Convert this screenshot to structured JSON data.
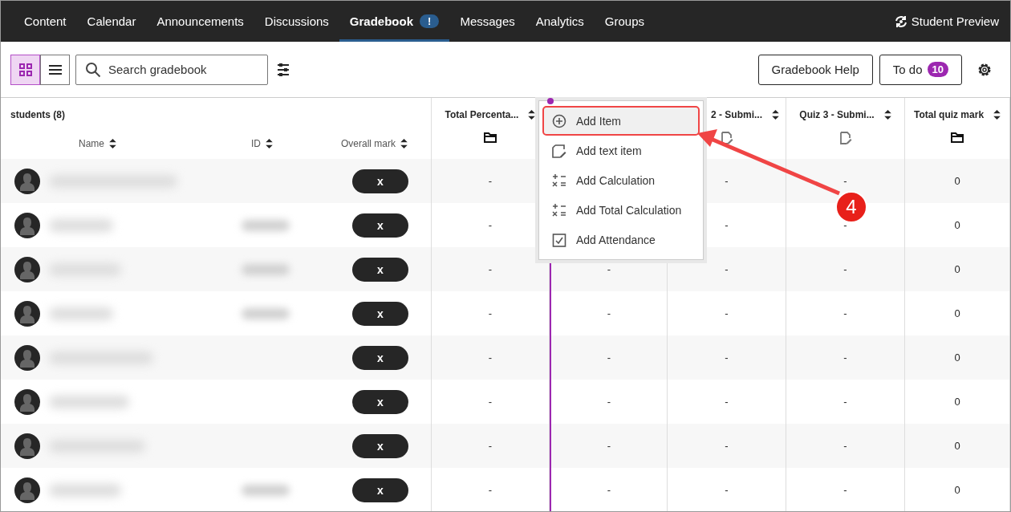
{
  "nav": {
    "tabs": [
      {
        "label": "Content",
        "selected": false
      },
      {
        "label": "Calendar",
        "selected": false
      },
      {
        "label": "Announcements",
        "selected": false
      },
      {
        "label": "Discussions",
        "selected": false
      },
      {
        "label": "Gradebook",
        "selected": true,
        "badge": "!"
      },
      {
        "label": "Messages",
        "selected": false
      },
      {
        "label": "Analytics",
        "selected": false
      },
      {
        "label": "Groups",
        "selected": false
      }
    ],
    "preview": "Student Preview"
  },
  "toolbar": {
    "views": [
      {
        "kind": "grid",
        "selected": true
      },
      {
        "kind": "list",
        "selected": false
      }
    ],
    "search": {
      "placeholder": "Search gradebook"
    },
    "help": "Gradebook Help",
    "todo": {
      "label": "To do",
      "count": "10"
    }
  },
  "students": {
    "title": "students (8)",
    "columns": [
      "Name",
      "ID",
      "Overall mark"
    ]
  },
  "columns": [
    {
      "kind": "folder",
      "title": "Total Percenta..."
    },
    {
      "kind": "covered"
    },
    {
      "kind": "document",
      "title": "2 - Submi..."
    },
    {
      "kind": "document",
      "title": "Quiz 3 - Submi..."
    },
    {
      "kind": "folder",
      "title": "Total quiz mark"
    }
  ],
  "rows": [
    {
      "mark": "x",
      "cells": [
        "-",
        null,
        "-",
        "-",
        "0"
      ]
    },
    {
      "mark": "x",
      "cells": [
        "-",
        null,
        "-",
        "-",
        "0"
      ]
    },
    {
      "mark": "x",
      "cells": [
        "-",
        "-",
        "-",
        "-",
        "0"
      ]
    },
    {
      "mark": "x",
      "cells": [
        "-",
        "-",
        "-",
        "-",
        "0"
      ]
    },
    {
      "mark": "x",
      "cells": [
        "-",
        "-",
        "-",
        "-",
        "0"
      ]
    },
    {
      "mark": "x",
      "cells": [
        "-",
        "-",
        "-",
        "-",
        "0"
      ]
    },
    {
      "mark": "x",
      "cells": [
        "-",
        "-",
        "-",
        "-",
        "0"
      ]
    },
    {
      "mark": "x",
      "cells": [
        "-",
        "-",
        "-",
        "-",
        "0"
      ]
    }
  ],
  "menu": {
    "items": [
      {
        "kind": "add",
        "label": "Add Item",
        "selected": true
      },
      {
        "kind": "text",
        "label": "Add text item",
        "selected": false
      },
      {
        "kind": "calc",
        "label": "Add Calculation",
        "selected": false
      },
      {
        "kind": "calc",
        "label": "Add Total Calculation",
        "selected": false
      },
      {
        "kind": "attendance",
        "label": "Add Attendance",
        "selected": false
      }
    ]
  },
  "annotation": {
    "step": "4"
  }
}
